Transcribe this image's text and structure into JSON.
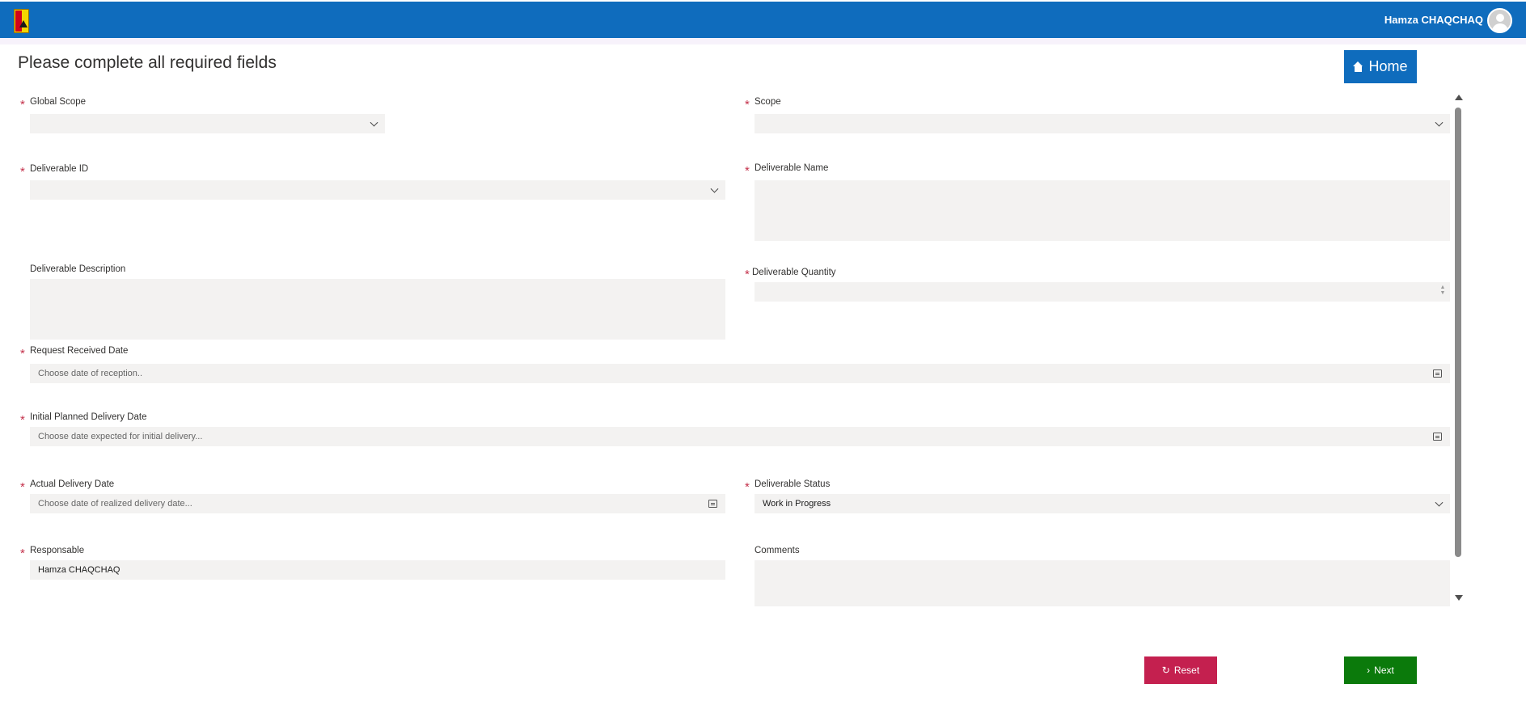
{
  "header": {
    "user_name": "Hamza CHAQCHAQ"
  },
  "page": {
    "title": "Please complete all required fields"
  },
  "buttons": {
    "home": "Home",
    "reset": "Reset",
    "next": "Next"
  },
  "form": {
    "required_marker": "*",
    "global_scope": {
      "label": "Global Scope",
      "value": ""
    },
    "scope": {
      "label": "Scope",
      "value": ""
    },
    "deliverable_id": {
      "label": "Deliverable ID",
      "value": ""
    },
    "deliverable_name": {
      "label": "Deliverable Name",
      "value": ""
    },
    "deliverable_description": {
      "label": "Deliverable Description",
      "value": ""
    },
    "deliverable_quantity": {
      "label": "Deliverable Quantity",
      "value": ""
    },
    "request_received_date": {
      "label": "Request Received Date",
      "placeholder": "Choose date of reception.."
    },
    "initial_planned_delivery_date": {
      "label": "Initial Planned Delivery Date",
      "placeholder": "Choose date expected for initial delivery..."
    },
    "actual_delivery_date": {
      "label": "Actual Delivery Date",
      "placeholder": "Choose date of realized delivery date..."
    },
    "deliverable_status": {
      "label": "Deliverable Status",
      "value": "Work in Progress"
    },
    "responsable": {
      "label": "Responsable",
      "value": "Hamza CHAQCHAQ"
    },
    "comments": {
      "label": "Comments",
      "value": ""
    }
  },
  "colors": {
    "header_bg": "#0f6cbd",
    "home_button": "#0f6cbd",
    "reset_button": "#c4204f",
    "next_button": "#0b7a0b",
    "required_marker": "#c4314b",
    "field_bg": "#f3f2f1"
  },
  "icons": {
    "logo": "app-logo-icon",
    "avatar": "user-avatar-icon",
    "home": "home-icon",
    "reset": "reset-icon",
    "next": "chevron-right-icon",
    "dropdown": "chevron-down-icon",
    "calendar": "calendar-icon"
  }
}
